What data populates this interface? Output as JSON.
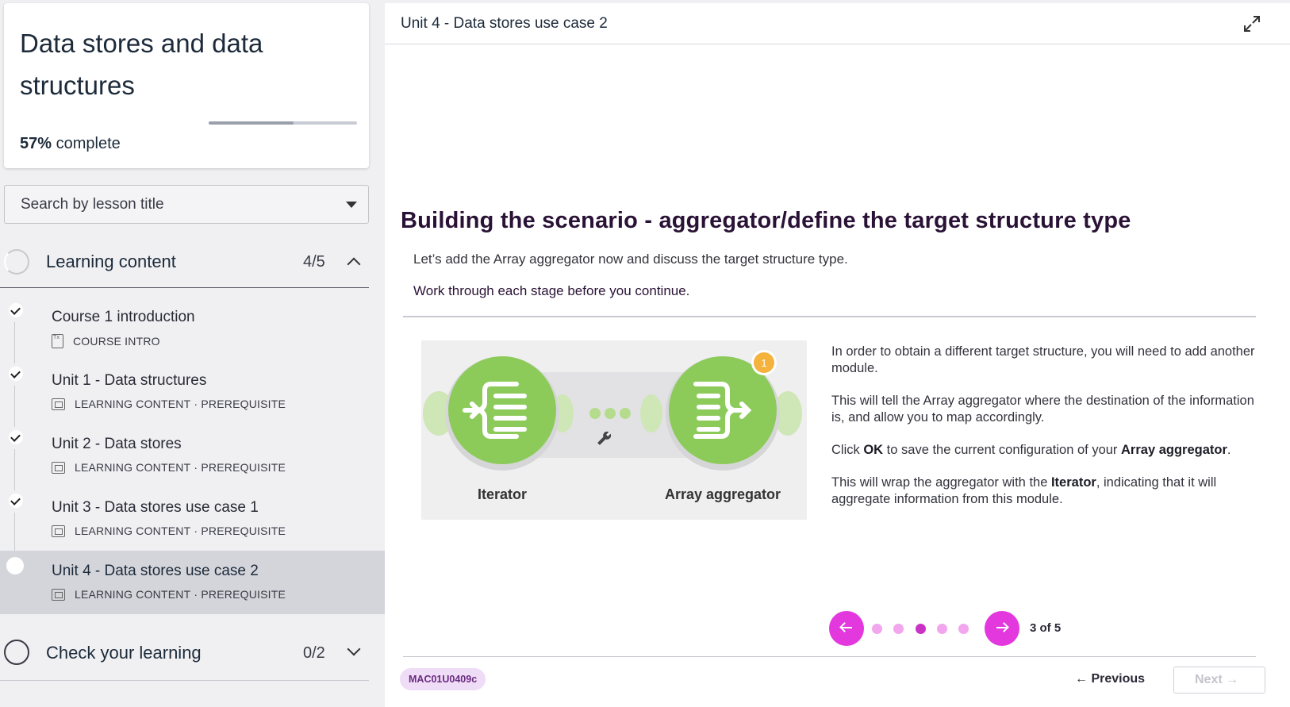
{
  "course": {
    "title": "Data stores and data structures",
    "progress_percent": 57,
    "progress_bold": "57%",
    "progress_suffix": "complete"
  },
  "search": {
    "placeholder": "Search by lesson title"
  },
  "sections": [
    {
      "label": "Learning content",
      "count": "4/5",
      "expanded": true
    },
    {
      "label": "Check your learning",
      "count": "0/2",
      "expanded": false
    }
  ],
  "lessons": [
    {
      "title": "Course 1 introduction",
      "type": "COURSE INTRO",
      "tag": "",
      "done": true
    },
    {
      "title": "Unit 1 - Data structures",
      "type": "LEARNING CONTENT",
      "tag": "PREREQUISITE",
      "done": true
    },
    {
      "title": "Unit 2 - Data stores",
      "type": "LEARNING CONTENT",
      "tag": "PREREQUISITE",
      "done": true
    },
    {
      "title": "Unit 3 - Data stores use case 1",
      "type": "LEARNING CONTENT",
      "tag": "PREREQUISITE",
      "done": true
    },
    {
      "title": "Unit 4 - Data stores use case 2",
      "type": "LEARNING CONTENT",
      "tag": "PREREQUISITE",
      "done": false,
      "active": true
    }
  ],
  "meta_sep": "·",
  "main": {
    "unit_title": "Unit 4 - Data stores use case 2",
    "heading": "Building the scenario - aggregator/define the target structure type",
    "intro": "Let’s add the Array aggregator now and discuss the target structure type.",
    "instruction": "Work through each stage before you continue.",
    "diagram": {
      "left_label": "Iterator",
      "right_label": "Array aggregator",
      "badge": "1"
    },
    "paragraphs": {
      "p1": "In order to obtain a different target structure, you will need to add another module.",
      "p2": "This will tell the Array aggregator where the destination of the information is, and allow you to map accordingly.",
      "p3a": "Click ",
      "p3b": "OK",
      "p3c": " to save the current configuration of your ",
      "p3d": "Array aggregator",
      "p3e": ".",
      "p4a": "This will wrap the aggregator with the ",
      "p4b": "Iterator",
      "p4c": ", indicating that it will aggregate information from this module."
    },
    "pager": {
      "current": 3,
      "total": 5,
      "label": "3 of 5"
    },
    "code": "MAC01U0409c",
    "previous_label": "← Previous",
    "next_label": "Next →"
  },
  "colors": {
    "accent": "#e238dd",
    "module_green": "#8ccb5a",
    "heading": "#2a1236",
    "badge_bg": "#efdcf6"
  }
}
